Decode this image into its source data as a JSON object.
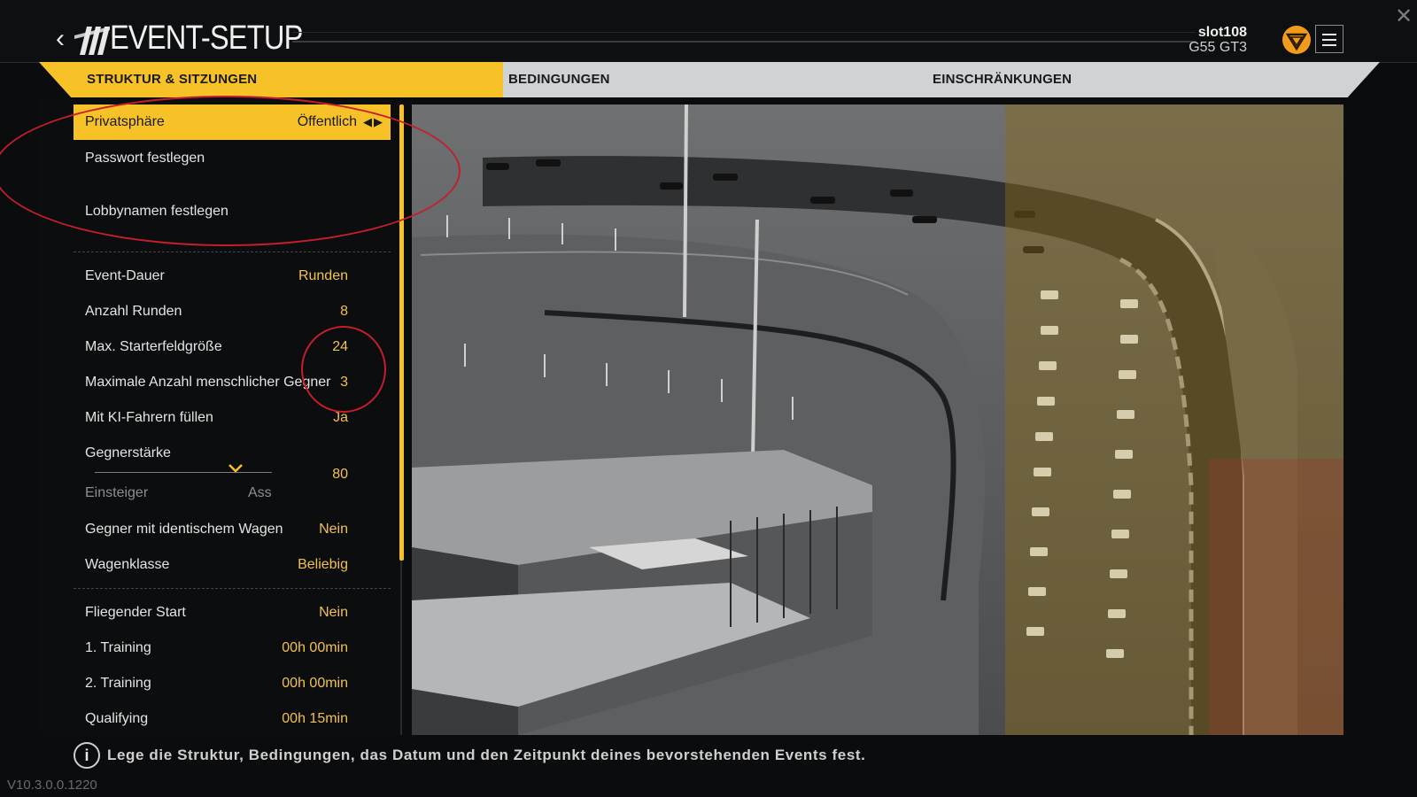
{
  "window": {
    "close_icon": "close-icon"
  },
  "header": {
    "title": "EVENT-SETUP",
    "back_icon": "chevron-left-icon",
    "profile_name": "slot108",
    "profile_car": "G55 GT3",
    "badge_icon": "team-shield-icon",
    "menu_icon": "hamburger-menu-icon",
    "accent_color": "#f6c227"
  },
  "tabs": [
    {
      "label": "STRUKTUR & SITZUNGEN",
      "active": true
    },
    {
      "label": "BEDINGUNGEN",
      "active": false
    },
    {
      "label": "EINSCHRÄNKUNGEN",
      "active": false
    }
  ],
  "settings": {
    "privacy": {
      "label": "Privatsphäre",
      "value": "Öffentlich"
    },
    "password": {
      "label": "Passwort festlegen"
    },
    "lobbyname": {
      "label": "Lobbynamen festlegen"
    },
    "event_duration": {
      "label": "Event-Dauer",
      "value": "Runden"
    },
    "laps": {
      "label": "Anzahl Runden",
      "value": "8"
    },
    "grid_size": {
      "label": "Max. Starterfeldgröße",
      "value": "24"
    },
    "human_opponents": {
      "label": "Maximale Anzahl menschlicher Gegner",
      "value": "3"
    },
    "ai_fill": {
      "label": "Mit KI-Fahrern füllen",
      "value": "Ja"
    },
    "ai_strength": {
      "label": "Gegnerstärke",
      "value": "80",
      "min_label": "Einsteiger",
      "max_label": "Ass",
      "level_fraction": 0.8
    },
    "identical_car": {
      "label": "Gegner mit identischem Wagen",
      "value": "Nein"
    },
    "car_class": {
      "label": "Wagenklasse",
      "value": "Beliebig"
    },
    "flying_start": {
      "label": "Fliegender Start",
      "value": "Nein"
    },
    "practice1": {
      "label": "1. Training",
      "value": "00h 00min"
    },
    "practice2": {
      "label": "2. Training",
      "value": "00h 00min"
    },
    "qualifying": {
      "label": "Qualifying",
      "value": "00h 15min"
    }
  },
  "footer": {
    "info_icon": "info-icon",
    "info_text": "Lege die Struktur, Bedingungen, das Datum und den Zeitpunkt deines bevorstehenden Events fest.",
    "version": "V10.3.0.0.1220"
  }
}
